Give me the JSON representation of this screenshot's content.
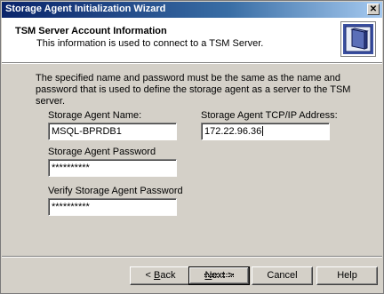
{
  "window": {
    "title": "Storage Agent Initialization Wizard",
    "close_glyph": "✕"
  },
  "header": {
    "title": "TSM Server Account Information",
    "subtitle": "This information is used to connect to a TSM Server.",
    "icon": "server-icon"
  },
  "description": "The specified name and password must be the same as the name and password that is used to define the storage agent  as a server to the TSM server.",
  "form": {
    "agent_name_label": "Storage Agent Name:",
    "agent_name_value": "MSQL-BPRDB1",
    "tcpip_label": "Storage Agent TCP/IP Address:",
    "tcpip_value": "172.22.96.36",
    "password_label": "Storage Agent Password",
    "password_value": "**********",
    "verify_label": "Verify Storage Agent Password",
    "verify_value": "**********"
  },
  "buttons": {
    "back": {
      "pre": "< ",
      "key": "B",
      "post": "ack"
    },
    "next": {
      "key": "N",
      "post": "ext >"
    },
    "cancel": "Cancel",
    "help": "Help"
  },
  "colors": {
    "titlebar_start": "#0a246a",
    "dialog_bg": "#d4d0c8"
  }
}
